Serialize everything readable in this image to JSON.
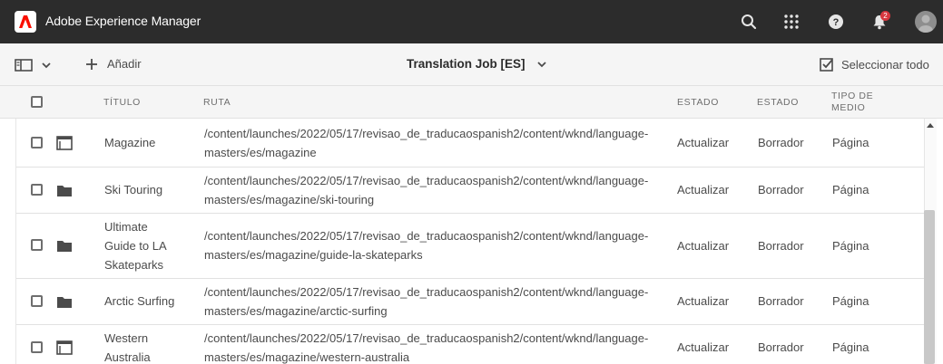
{
  "header": {
    "app_title": "Adobe Experience Manager",
    "notification_count": "2"
  },
  "actionbar": {
    "add_label": "Añadir",
    "title": "Translation Job [ES]",
    "select_all_label": "Seleccionar todo"
  },
  "table": {
    "columns": {
      "title": "TÍTULO",
      "path": "RUTA",
      "status1": "ESTADO",
      "status2": "ESTADO",
      "media_l1": "TIPO DE",
      "media_l2": "MEDIO"
    },
    "rows": [
      {
        "icon": "page-icon",
        "title_lines": [
          "Magazine"
        ],
        "path_lines": [
          "/content/launches/2022/05/17/revisao_de_traducaospanish2/content/wknd/language-",
          "masters/es/magazine"
        ],
        "status": "Actualizar",
        "state": "Borrador",
        "media": "Página"
      },
      {
        "icon": "folder-icon",
        "title_lines": [
          "Ski Touring"
        ],
        "path_lines": [
          "/content/launches/2022/05/17/revisao_de_traducaospanish2/content/wknd/language-",
          "masters/es/magazine/ski-touring"
        ],
        "status": "Actualizar",
        "state": "Borrador",
        "media": "Página"
      },
      {
        "icon": "folder-icon",
        "title_lines": [
          "Ultimate",
          "Guide to LA",
          "Skateparks"
        ],
        "path_lines": [
          "/content/launches/2022/05/17/revisao_de_traducaospanish2/content/wknd/language-",
          "masters/es/magazine/guide-la-skateparks"
        ],
        "status": "Actualizar",
        "state": "Borrador",
        "media": "Página"
      },
      {
        "icon": "folder-icon",
        "title_lines": [
          "Arctic Surfing"
        ],
        "path_lines": [
          "/content/launches/2022/05/17/revisao_de_traducaospanish2/content/wknd/language-",
          "masters/es/magazine/arctic-surfing"
        ],
        "status": "Actualizar",
        "state": "Borrador",
        "media": "Página"
      },
      {
        "icon": "page-icon",
        "title_lines": [
          "Western",
          "Australia"
        ],
        "path_lines": [
          "/content/launches/2022/05/17/revisao_de_traducaospanish2/content/wknd/language-",
          "masters/es/magazine/western-australia"
        ],
        "status": "Actualizar",
        "state": "Borrador",
        "media": "Página"
      }
    ]
  },
  "colors": {
    "topbar": "#2c2c2c",
    "accent_badge": "#d7373f",
    "actionbar": "#f5f5f5"
  }
}
